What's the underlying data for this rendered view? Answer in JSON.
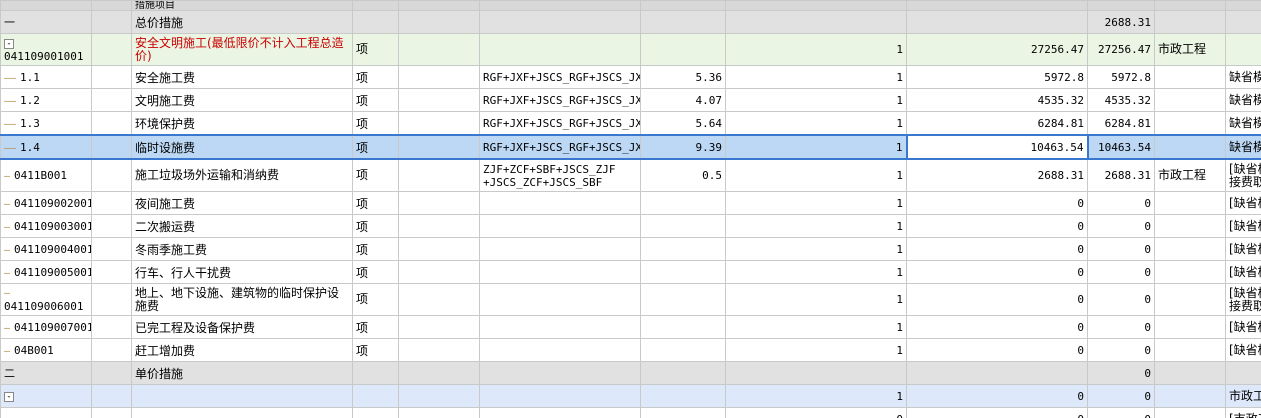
{
  "top_row": {
    "name": "措施项目"
  },
  "rows": [
    {
      "kind": "sect",
      "code": "一",
      "name": "总价措施",
      "unit": "",
      "formula": "",
      "rate": "",
      "qty": "",
      "price": "",
      "total": "2688.31",
      "major": "",
      "extra": ""
    },
    {
      "kind": "grp",
      "code": "041109001001",
      "name": "安全文明施工(最低限价不计入工程总造价)",
      "unit": "项",
      "formula": "",
      "rate": "",
      "qty": "1",
      "price": "27256.47",
      "total": "27256.47",
      "major": "市政工程",
      "extra": ""
    },
    {
      "kind": "item",
      "code": "1.1",
      "name": "安全施工费",
      "unit": "项",
      "formula": "RGF+JXF+JSCS_RGF+JSCS_JXF",
      "rate": "5.36",
      "qty": "1",
      "price": "5972.8",
      "total": "5972.8",
      "major": "",
      "extra": "缺省模"
    },
    {
      "kind": "item",
      "code": "1.2",
      "name": "文明施工费",
      "unit": "项",
      "formula": "RGF+JXF+JSCS_RGF+JSCS_JXF",
      "rate": "4.07",
      "qty": "1",
      "price": "4535.32",
      "total": "4535.32",
      "major": "",
      "extra": "缺省模"
    },
    {
      "kind": "item",
      "code": "1.3",
      "name": "环境保护费",
      "unit": "项",
      "formula": "RGF+JXF+JSCS_RGF+JSCS_JXF",
      "rate": "5.64",
      "qty": "1",
      "price": "6284.81",
      "total": "6284.81",
      "major": "",
      "extra": "缺省模"
    },
    {
      "kind": "sel",
      "code": "1.4",
      "name": "临时设施费",
      "unit": "项",
      "formula": "RGF+JXF+JSCS_RGF+JSCS_JXF",
      "rate": "9.39",
      "qty": "1",
      "price": "10463.54",
      "total": "10463.54",
      "major": "",
      "extra": "缺省模"
    },
    {
      "kind": "tall",
      "code": "0411B001",
      "name": "施工垃圾场外运输和消纳费",
      "unit": "项",
      "formula": "ZJF+ZCF+SBF+JSCS_ZJF +JSCS_ZCF+JSCS_SBF",
      "rate": "0.5",
      "qty": "1",
      "price": "2688.31",
      "total": "2688.31",
      "major": "市政工程",
      "extra": "[缺省模 接费取"
    },
    {
      "kind": "plain",
      "code": "041109002001",
      "name": "夜间施工费",
      "unit": "项",
      "formula": "",
      "rate": "",
      "qty": "1",
      "price": "0",
      "total": "0",
      "major": "",
      "extra": "[缺省模"
    },
    {
      "kind": "plain",
      "code": "041109003001",
      "name": "二次搬运费",
      "unit": "项",
      "formula": "",
      "rate": "",
      "qty": "1",
      "price": "0",
      "total": "0",
      "major": "",
      "extra": "[缺省模"
    },
    {
      "kind": "plain",
      "code": "041109004001",
      "name": "冬雨季施工费",
      "unit": "项",
      "formula": "",
      "rate": "",
      "qty": "1",
      "price": "0",
      "total": "0",
      "major": "",
      "extra": "[缺省模"
    },
    {
      "kind": "plain",
      "code": "041109005001",
      "name": "行车、行人干扰费",
      "unit": "项",
      "formula": "",
      "rate": "",
      "qty": "1",
      "price": "0",
      "total": "0",
      "major": "",
      "extra": "[缺省模"
    },
    {
      "kind": "tall",
      "code": "041109006001",
      "name": "地上、地下设施、建筑物的临时保护设施费",
      "unit": "项",
      "formula": "",
      "rate": "",
      "qty": "1",
      "price": "0",
      "total": "0",
      "major": "",
      "extra": "[缺省模 接费取"
    },
    {
      "kind": "plain",
      "code": "041109007001",
      "name": "已完工程及设备保护费",
      "unit": "项",
      "formula": "",
      "rate": "",
      "qty": "1",
      "price": "0",
      "total": "0",
      "major": "",
      "extra": "[缺省模"
    },
    {
      "kind": "plain",
      "code": "04B001",
      "name": "赶工增加费",
      "unit": "项",
      "formula": "",
      "rate": "",
      "qty": "1",
      "price": "0",
      "total": "0",
      "major": "",
      "extra": "[缺省模"
    },
    {
      "kind": "sect",
      "code": "二",
      "name": "单价措施",
      "unit": "",
      "formula": "",
      "rate": "",
      "qty": "",
      "price": "",
      "total": "0",
      "major": "",
      "extra": ""
    },
    {
      "kind": "grp2",
      "code": "",
      "name": "",
      "unit": "",
      "formula": "",
      "rate": "",
      "qty": "1",
      "price": "0",
      "total": "0",
      "major": "",
      "extra": "市政工"
    },
    {
      "kind": "plain",
      "code": "",
      "name": "",
      "unit": "",
      "formula": "",
      "rate": "",
      "qty": "0",
      "price": "0",
      "total": "0",
      "major": "",
      "extra": "[市政工"
    }
  ],
  "colors": {
    "section_bg": "#e1e1e1",
    "group_bg": "#eaf5e4",
    "selected_bg": "#bcd8f4",
    "selected_border": "#3a78cf",
    "red_text": "#cc0000"
  }
}
